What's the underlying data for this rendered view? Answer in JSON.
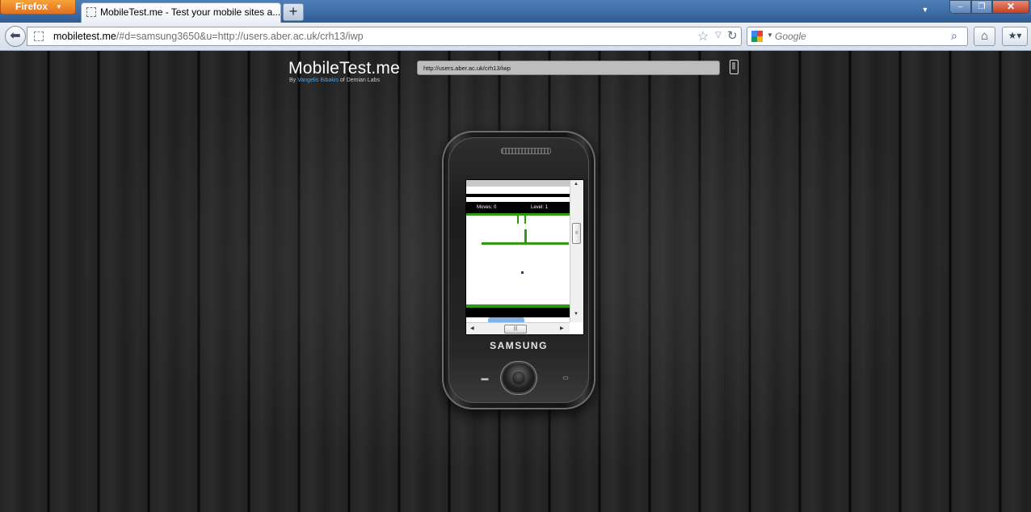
{
  "browser": {
    "app_button_label": "Firefox",
    "tab_title": "MobileTest.me - Test your mobile sites a...",
    "new_tab_label": "+",
    "url_host": "mobiletest.me",
    "url_path": "/#d=samsung3650&u=http://users.aber.ac.uk/crh13/iwp",
    "search_placeholder": "Google",
    "window_controls": {
      "minimize": "–",
      "maximize": "❐",
      "close": "✕"
    }
  },
  "page": {
    "site_title": "MobileTest.me",
    "byline_prefix": "By ",
    "byline_author": "Vangelis Bibakis",
    "byline_suffix": " of Demian Labs",
    "test_url": "http://users.aber.ac.uk/crh13/iwp"
  },
  "phone": {
    "brand": "SAMSUNG",
    "game": {
      "moves_label": "Moves: 0",
      "level_label": "Level: 1"
    }
  },
  "colors": {
    "firefox_orange": "#e2701b",
    "maze_wall": "#2e9a0f",
    "player_dot": "#5b2a6e",
    "author_link": "#4aa3e8"
  },
  "icons": {
    "back": "arrow-left",
    "bookmark": "star",
    "reload": "reload",
    "search": "magnifier",
    "home": "home",
    "bookmarks_menu": "bookmarks",
    "device": "phone"
  }
}
